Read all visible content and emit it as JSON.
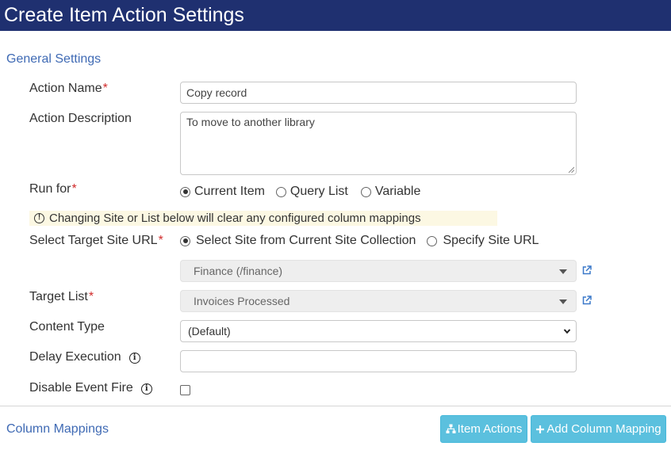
{
  "header": {
    "title": "Create Item Action Settings"
  },
  "sections": {
    "general": "General Settings",
    "column_mappings": "Column Mappings"
  },
  "fields": {
    "action_name": {
      "label": "Action Name",
      "required_mark": "*",
      "value": "Copy record"
    },
    "action_description": {
      "label": "Action Description",
      "value": "To move to another library"
    },
    "run_for": {
      "label": "Run for",
      "required_mark": "*",
      "options": [
        "Current Item",
        "Query List",
        "Variable"
      ],
      "selected": "Current Item"
    },
    "warning": {
      "icon": "exclamation-circle-icon",
      "text": "Changing Site or List below will clear any configured column mappings"
    },
    "target_site": {
      "label": "Select Target Site URL",
      "required_mark": "*",
      "options": [
        "Select Site from Current Site Collection",
        "Specify Site URL"
      ],
      "selected": "Select Site from Current Site Collection",
      "site_value": "Finance (/finance)"
    },
    "target_list": {
      "label": "Target List",
      "required_mark": "*",
      "value": "Invoices Processed"
    },
    "content_type": {
      "label": "Content Type",
      "value": "(Default)"
    },
    "delay_execution": {
      "label": "Delay Execution",
      "value": ""
    },
    "disable_event_fire": {
      "label": "Disable Event Fire",
      "checked": false
    }
  },
  "buttons": {
    "item_actions": "Item Actions",
    "add_column_mapping": "Add Column Mapping"
  },
  "colors": {
    "header_bg": "#1f3070",
    "section_title": "#3f6ab4",
    "required": "#d12b2b",
    "button_bg": "#5bc0de",
    "warning_bg": "#fcf8e3"
  }
}
